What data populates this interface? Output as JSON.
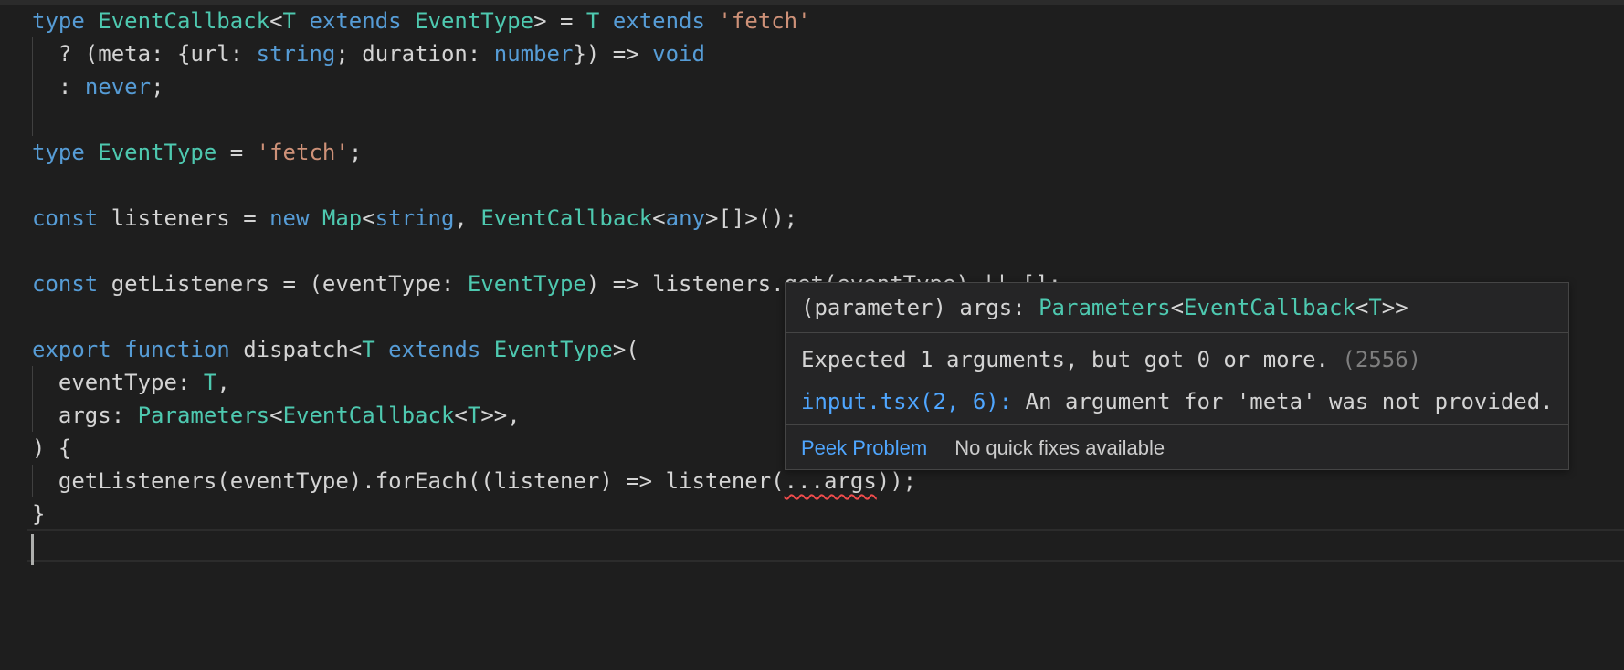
{
  "code": {
    "line1": {
      "t1": "type",
      "t2": "EventCallback",
      "t3": "<",
      "t4": "T",
      "t5": "extends",
      "t6": "EventType",
      "t7": "> = ",
      "t8": "T",
      "t9": "extends",
      "t10": "'fetch'"
    },
    "line2": {
      "t1": "? (meta: {url: ",
      "t2": "string",
      "t3": "; duration: ",
      "t4": "number",
      "t5": "}) => ",
      "t6": "void"
    },
    "line3": {
      "t1": ": ",
      "t2": "never",
      "t3": ";"
    },
    "line5": {
      "t1": "type",
      "t2": "EventType",
      "t3": " = ",
      "t4": "'fetch'",
      "t5": ";"
    },
    "line7": {
      "t1": "const",
      "t2": " listeners = ",
      "t3": "new",
      "t4": "Map",
      "t5": "<",
      "t6": "string",
      "t7": ", ",
      "t8": "EventCallback",
      "t9": "<",
      "t10": "any",
      "t11": ">[]>();"
    },
    "line9": {
      "t1": "const",
      "t2": " getListeners = (eventType: ",
      "t3": "EventType",
      "t4": ") => listeners.get(eventType) || [];"
    },
    "line11": {
      "t1": "export",
      "t2": "function",
      "t3": " dispatch<",
      "t4": "T",
      "t5": "extends",
      "t6": "EventType",
      "t7": ">("
    },
    "line12": {
      "t1": "eventType: ",
      "t2": "T",
      "t3": ","
    },
    "line13": {
      "t1": "args: ",
      "t2": "Parameters",
      "t3": "<",
      "t4": "EventCallback",
      "t5": "<",
      "t6": "T",
      "t7": ">>,"
    },
    "line14": {
      "t1": ") {"
    },
    "line15": {
      "t1": "getListeners(eventType).forEach((listener) => listener(",
      "t2": "...args",
      "t3": "));"
    },
    "line16": {
      "t1": "}"
    }
  },
  "hover": {
    "signature": {
      "prefix": "(parameter) args: ",
      "type1": "Parameters",
      "lt1": "<",
      "type2": "EventCallback",
      "lt2": "<",
      "type3": "T",
      "close": ">>"
    },
    "error_message": "Expected 1 arguments, but got 0 or more.",
    "error_code": "(2556)",
    "related_location": "input.tsx(2, 6):",
    "related_message": " An argument for 'meta' was not provided.",
    "peek_problem_label": "Peek Problem",
    "no_fixes_label": "No quick fixes available"
  },
  "colors": {
    "background": "#1e1e1e",
    "keyword": "#569cd6",
    "type": "#4ec9b0",
    "string": "#ce9178",
    "error_squiggle": "#f14c4c",
    "link": "#4fa6ff"
  }
}
